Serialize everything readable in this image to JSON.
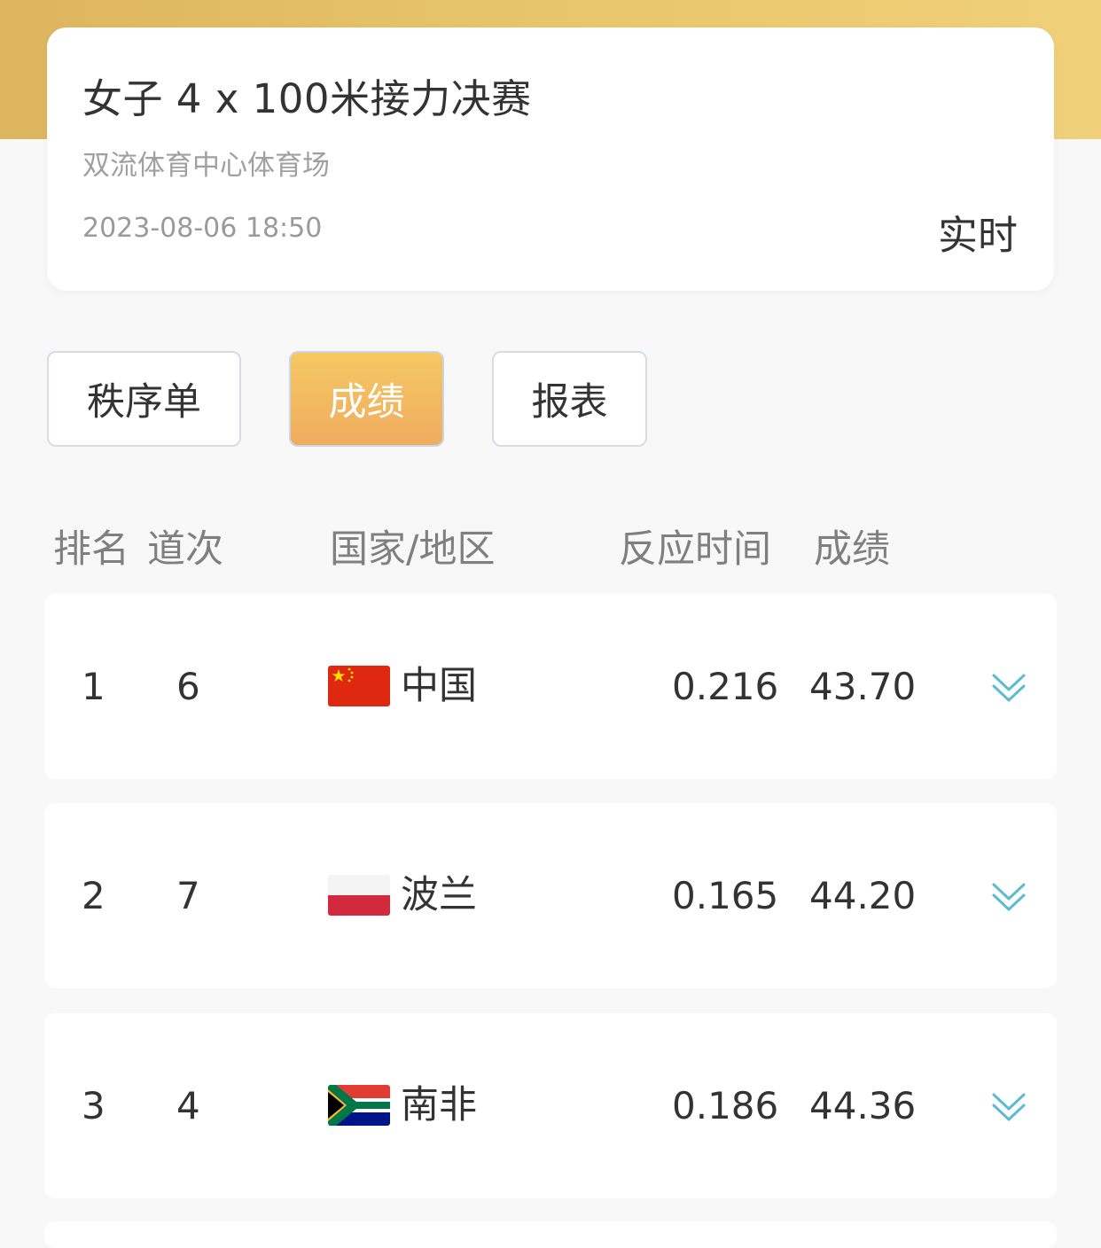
{
  "event": {
    "title": "女子 4 x 100米接力决赛",
    "venue": "双流体育中心体育场",
    "datetime": "2023-08-06 18:50",
    "live_label": "实时"
  },
  "tabs": [
    {
      "label": "秩序单",
      "active": false
    },
    {
      "label": "成绩",
      "active": true
    },
    {
      "label": "报表",
      "active": false
    }
  ],
  "columns": {
    "rank": "排名",
    "lane": "道次",
    "country": "国家/地区",
    "reaction": "反应时间",
    "result": "成绩"
  },
  "rows": [
    {
      "rank": "1",
      "lane": "6",
      "country": "中国",
      "flag": "china-flag-icon",
      "reaction": "0.216",
      "result": "43.70"
    },
    {
      "rank": "2",
      "lane": "7",
      "country": "波兰",
      "flag": "poland-flag-icon",
      "reaction": "0.165",
      "result": "44.20"
    },
    {
      "rank": "3",
      "lane": "4",
      "country": "南非",
      "flag": "south-africa-flag-icon",
      "reaction": "0.186",
      "result": "44.36"
    }
  ],
  "colors": {
    "header_gold": "#e8c56a",
    "active_tab": "#f2b862",
    "expand_icon": "#5bbcd0",
    "text_primary": "#333333",
    "text_secondary": "#a0a0a0"
  }
}
